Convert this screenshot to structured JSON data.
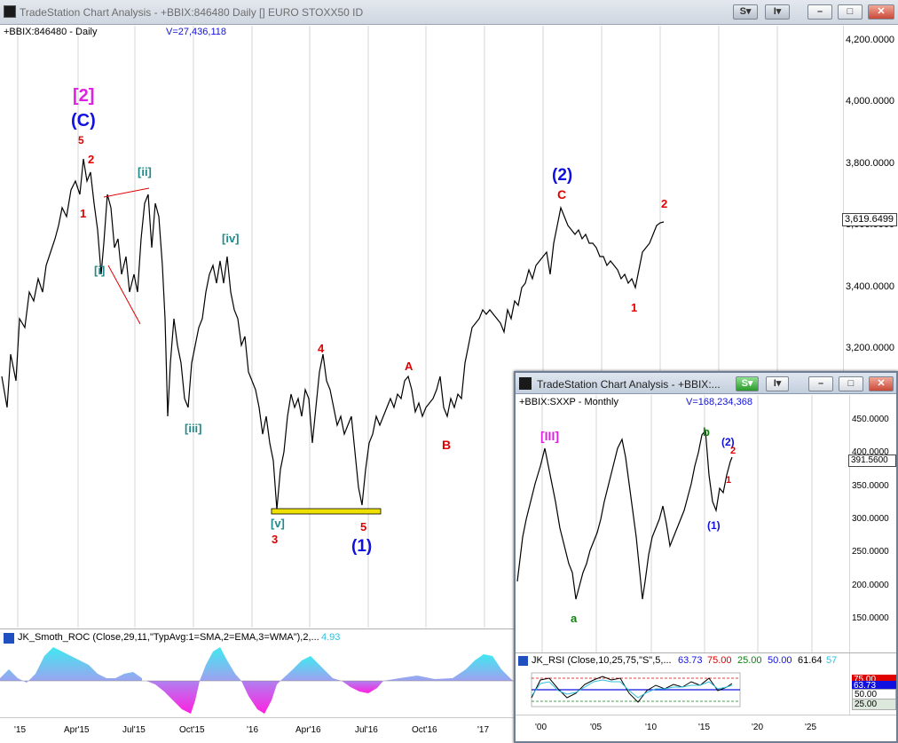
{
  "window": {
    "title": "TradeStation Chart Analysis - +BBIX:846480 Daily [] EURO STOXX50 ID",
    "btn_s": "S",
    "btn_i": "I",
    "min": "–",
    "max": "□",
    "close": "✕"
  },
  "chart": {
    "symbol_label": "+BBIX:846480 - Daily",
    "volume_label": "V=27,436,118",
    "y_ticks": [
      "4,200.0000",
      "4,000.0000",
      "3,800.0000",
      "3,600.0000",
      "3,400.0000",
      "3,200.0000"
    ],
    "last_price": "3,619.6499",
    "x_ticks": [
      "'15",
      "Apr'15",
      "Jul'15",
      "Oct'15",
      "'16",
      "Apr'16",
      "Jul'16",
      "Oct'16",
      "'17"
    ],
    "colors": {
      "price": "#000000",
      "red": "#e00000",
      "blue": "#1010e0",
      "teal": "#1e8a8a",
      "magenta": "#e020e0",
      "support_fill": "#f0e000"
    },
    "labels": {
      "w2_bracket": "[2]",
      "wC_paren": "(C)",
      "w5_top": "5",
      "w2_top": "2",
      "w1_top": "1",
      "wii": "[ii]",
      "wi": "[i]",
      "wiv": "[iv]",
      "wiii": "[iii]",
      "wv": "[v]",
      "w3_low": "3",
      "w4": "4",
      "w5_low": "5",
      "w1_paren": "(1)",
      "wA": "A",
      "wB": "B",
      "wC": "C",
      "w2_paren": "(2)",
      "w1_recent": "1",
      "w2_recent": "2"
    }
  },
  "indicator": {
    "name": "JK_Smoth_ROC (Close,29,11,\"TypAvg:1=SMA,2=EMA,3=WMA\"),2,...",
    "value": "4.93"
  },
  "inset": {
    "title": "TradeStation Chart Analysis - +BBIX:...",
    "btn_s": "S",
    "btn_i": "I",
    "min": "–",
    "max": "□",
    "close": "✕",
    "symbol_label": "+BBIX:SXXP - Monthly",
    "volume_label": "V=168,234,368",
    "y_ticks": [
      "450.0000",
      "400.0000",
      "350.0000",
      "300.0000",
      "250.0000",
      "200.0000",
      "150.0000"
    ],
    "last_price": "391.5600",
    "x_ticks": [
      "'00",
      "'05",
      "'10",
      "'15",
      "'20",
      "'25"
    ],
    "labels": {
      "III": "[III]",
      "a": "a",
      "b": "b",
      "w2": "(2)",
      "w2r": "2",
      "w1r": "1",
      "w1": "(1)"
    },
    "rsi": {
      "name": "JK_RSI (Close,10,25,75,\"S\",5,...",
      "v1": "63.73",
      "v2": "75.00",
      "v3": "25.00",
      "v4": "50.00",
      "v5": "61.64",
      "v6": "57",
      "axis_75": "75.00",
      "axis_6373": "63.73",
      "axis_50": "50.00",
      "axis_25": "25.00"
    }
  }
}
